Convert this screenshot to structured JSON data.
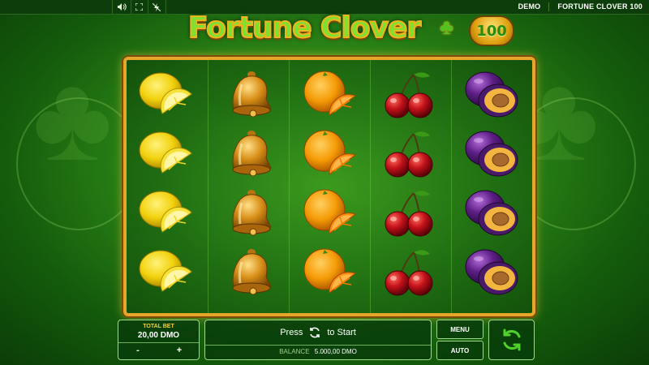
{
  "topbar": {
    "icons": [
      "sound-icon",
      "fullscreen-icon",
      "turbo-off-icon"
    ],
    "demo": "DEMO",
    "game_title": "FORTUNE CLOVER 100"
  },
  "logo": {
    "text": "Fortune Clover",
    "badge": "100"
  },
  "reels": {
    "columns": [
      {
        "symbol": "lemon",
        "rows": 4
      },
      {
        "symbol": "bell",
        "rows": 4
      },
      {
        "symbol": "orange",
        "rows": 4
      },
      {
        "symbol": "cherries",
        "rows": 4
      },
      {
        "symbol": "plum",
        "rows": 4
      }
    ]
  },
  "bet": {
    "label": "TOTAL BET",
    "value": "20,00 DMO",
    "minus": "-",
    "plus": "+"
  },
  "start": {
    "press": "Press",
    "to_start": "to Start"
  },
  "balance": {
    "label": "BALANCE",
    "value": "5.000,00 DMO"
  },
  "buttons": {
    "menu": "MENU",
    "auto": "AUTO"
  },
  "colors": {
    "frame": "#e7a52a",
    "text_accent": "#f3d22b",
    "spin_green": "#4fd12a"
  }
}
